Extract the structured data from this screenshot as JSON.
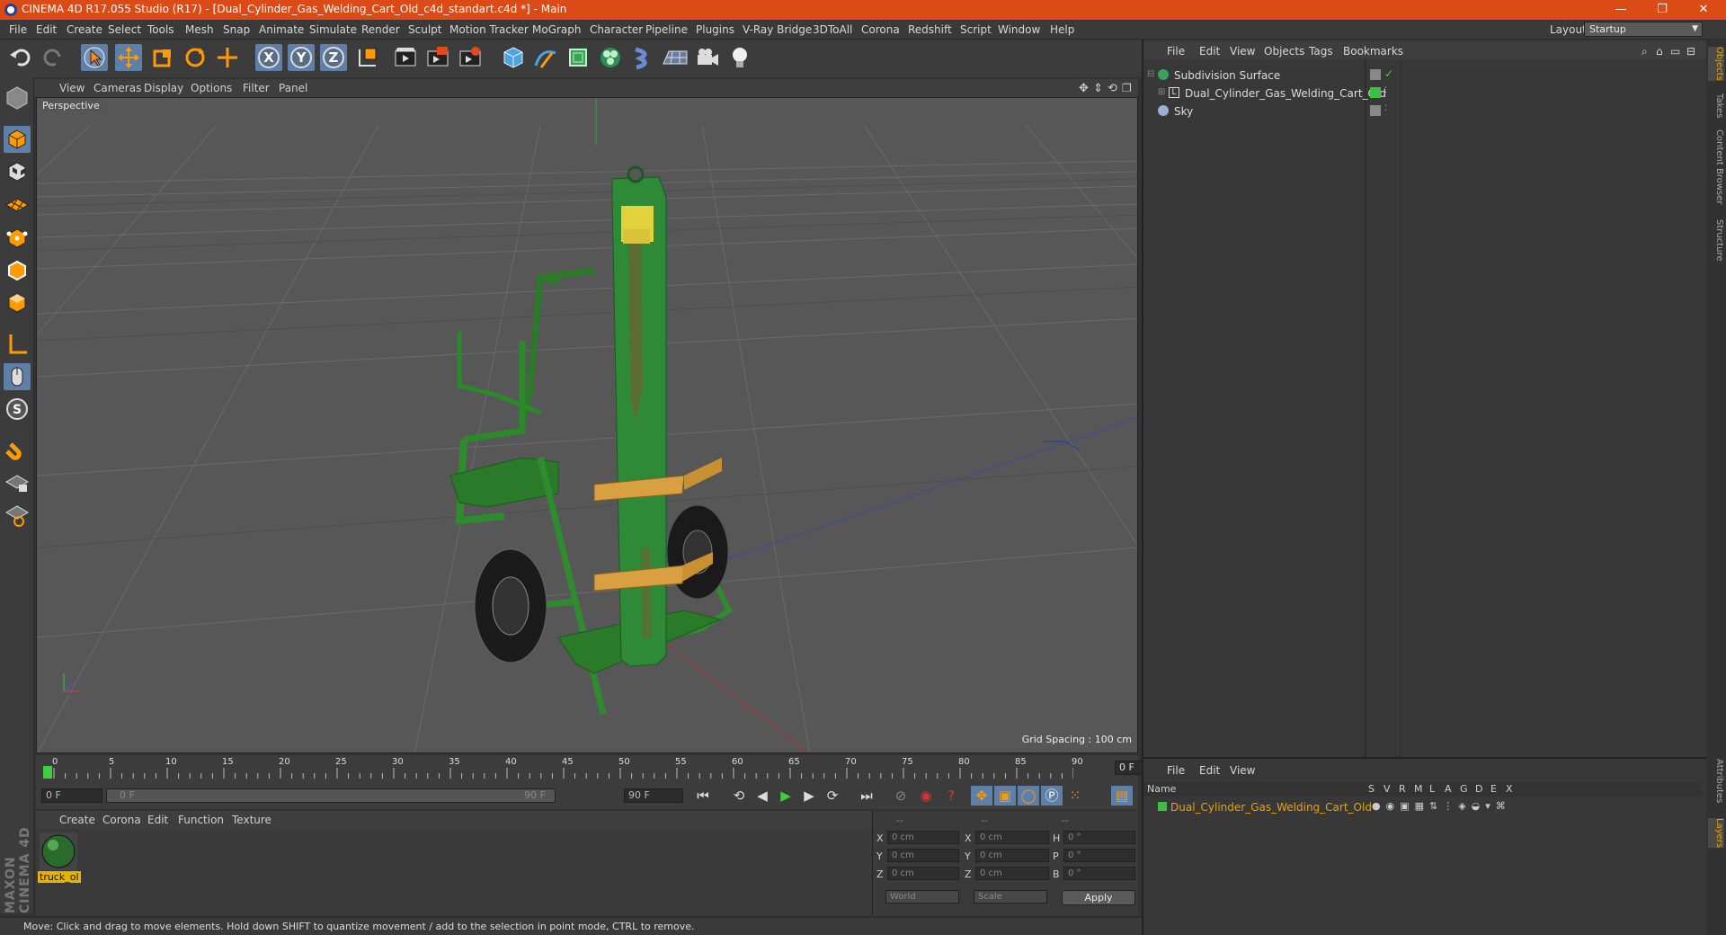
{
  "window": {
    "title": "CINEMA 4D R17.055 Studio (R17) - [Dual_Cylinder_Gas_Welding_Cart_Old_c4d_standart.c4d *] - Main",
    "minimize": "—",
    "restore": "❐",
    "close": "✕"
  },
  "menu": [
    "File",
    "Edit",
    "Create",
    "Select",
    "Tools",
    "Mesh",
    "Snap",
    "Animate",
    "Simulate",
    "Render",
    "Sculpt",
    "Motion Tracker",
    "MoGraph",
    "Character",
    "Pipeline",
    "Plugins",
    "V-Ray Bridge",
    "3DToAll",
    "Corona",
    "Redshift",
    "Script",
    "Window",
    "Help"
  ],
  "layout": {
    "label": "Layout:",
    "value": "Startup"
  },
  "viewport": {
    "menu": [
      "View",
      "Cameras",
      "Display",
      "Options",
      "Filter",
      "Panel"
    ],
    "label": "Perspective",
    "grid_spacing": "Grid Spacing : 100 cm"
  },
  "timeline": {
    "ticks": [
      "0",
      "5",
      "10",
      "15",
      "20",
      "25",
      "30",
      "35",
      "40",
      "45",
      "50",
      "55",
      "60",
      "65",
      "70",
      "75",
      "80",
      "85",
      "90"
    ],
    "current_frame": "0 F",
    "start_frame": "0 F",
    "range_start": "0 F",
    "range_end": "90 F",
    "end_frame": "90 F"
  },
  "materials": {
    "menu": [
      "Create",
      "Corona",
      "Edit",
      "Function",
      "Texture"
    ],
    "items": [
      {
        "name": "truck_ol"
      }
    ]
  },
  "coordinates": {
    "headers": [
      "--",
      "--",
      "--"
    ],
    "rows": [
      {
        "a": "X",
        "a_val": "0 cm",
        "b": "X",
        "b_val": "0 cm",
        "c": "H",
        "c_val": "0 °"
      },
      {
        "a": "Y",
        "a_val": "0 cm",
        "b": "Y",
        "b_val": "0 cm",
        "c": "P",
        "c_val": "0 °"
      },
      {
        "a": "Z",
        "a_val": "0 cm",
        "b": "Z",
        "b_val": "0 cm",
        "c": "B",
        "c_val": "0 °"
      }
    ],
    "mode1": "World",
    "mode2": "Scale",
    "apply": "Apply"
  },
  "status": "Move: Click and drag to move elements. Hold down SHIFT to quantize movement / add to the selection in point mode, CTRL to remove.",
  "objects": {
    "menu": [
      "File",
      "Edit",
      "View",
      "Objects",
      "Tags",
      "Bookmarks"
    ],
    "items": [
      {
        "name": "Subdivision Surface"
      },
      {
        "name": "Dual_Cylinder_Gas_Welding_Cart_Old"
      },
      {
        "name": "Sky"
      }
    ]
  },
  "layers": {
    "menu": [
      "File",
      "Edit",
      "View"
    ],
    "name_header": "Name",
    "columns": [
      "S",
      "V",
      "R",
      "M",
      "L",
      "A",
      "G",
      "D",
      "E",
      "X"
    ],
    "items": [
      {
        "name": "Dual_Cylinder_Gas_Welding_Cart_Old"
      }
    ]
  },
  "side_tabs": [
    "Objects",
    "Takes",
    "Content Browser",
    "Structure"
  ],
  "side_tabs_bottom": [
    "Attributes",
    "Layers"
  ],
  "brand": "MAXON CINEMA 4D",
  "colors": {
    "titlebar": "#dc4a18",
    "selection": "#5e7fa8",
    "accent": "#e9a200"
  }
}
